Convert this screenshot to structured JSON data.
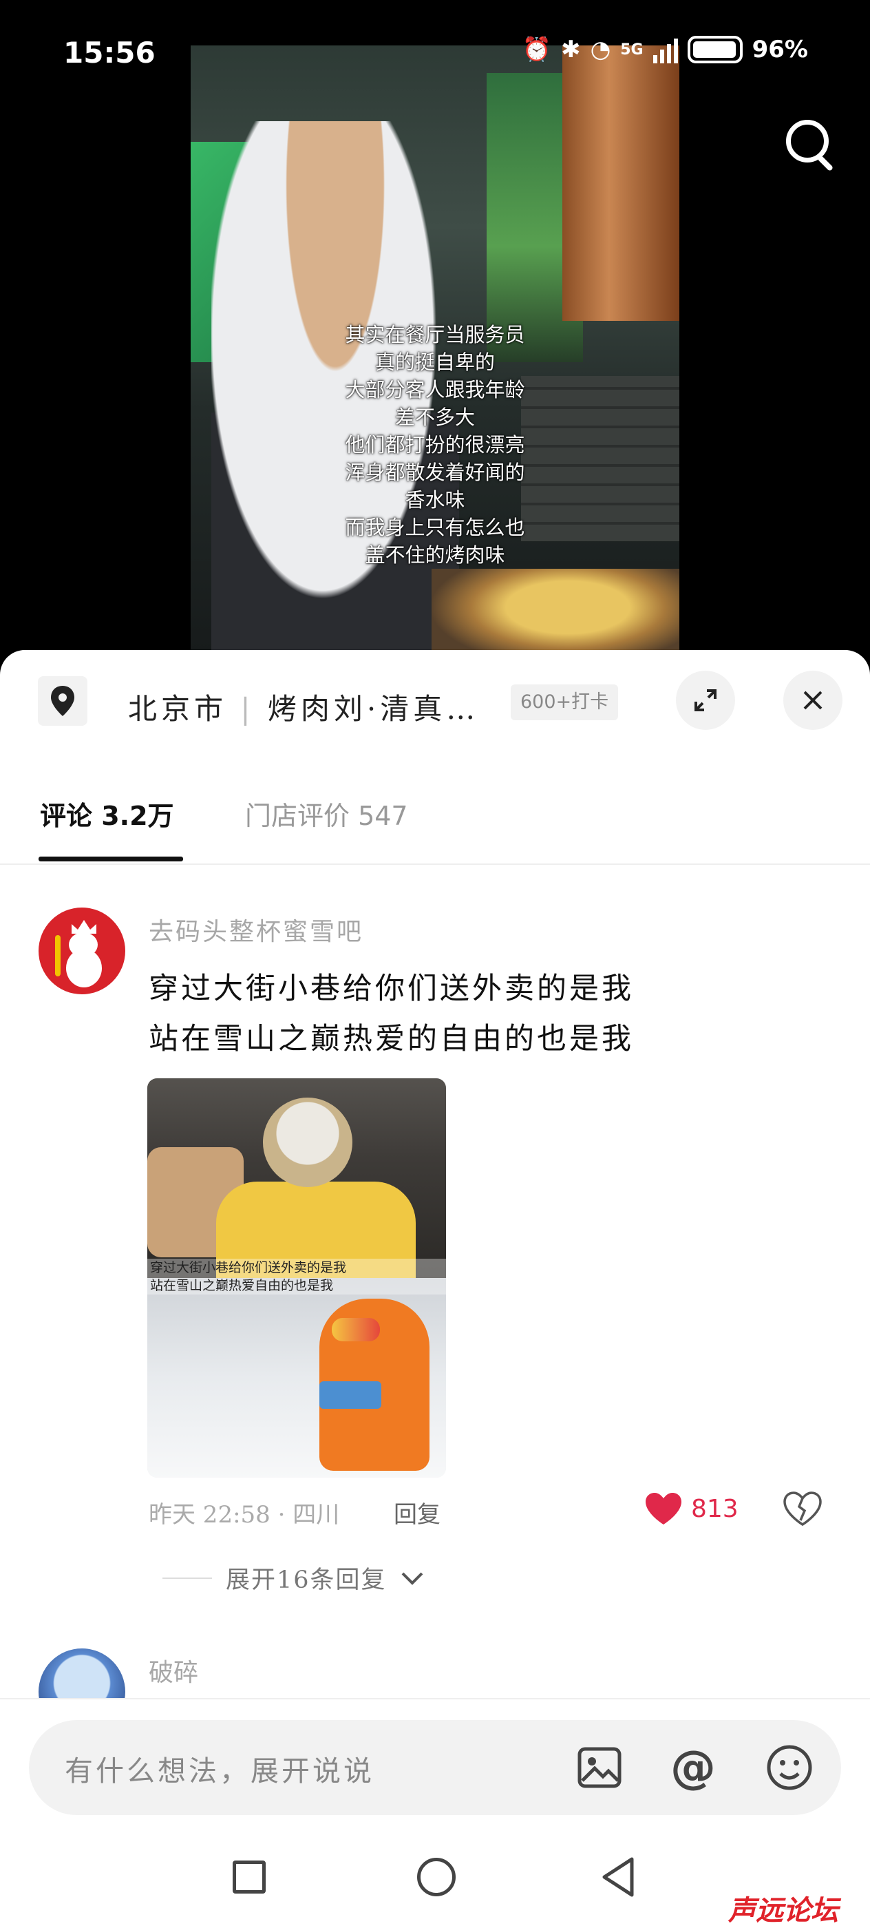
{
  "status_bar": {
    "time": "15:56",
    "network": "5G",
    "battery": "96%"
  },
  "video": {
    "caption_lines": [
      "其实在餐厅当服务员",
      "真的挺自卑的",
      "大部分客人跟我年龄",
      "差不多大",
      "他们都打扮的很漂亮",
      "浑身都散发着好闻的",
      "香水味",
      "而我身上只有怎么也",
      "盖不住的烤肉味"
    ]
  },
  "location": {
    "city": "北京市",
    "separator": "|",
    "place": "烤肉刘·清真…",
    "checkin": "600+打卡"
  },
  "tabs": [
    {
      "label": "评论 3.2万"
    },
    {
      "label": "门店评价 547"
    }
  ],
  "comment": {
    "user": "去码头整杯蜜雪吧",
    "text_line1": "穿过大街小巷给你们送外卖的是我",
    "text_line2": "站在雪山之巅热爱的自由的也是我",
    "image_caption_line1": "穿过大街小巷给你们送外卖的是我",
    "image_caption_line2": "站在雪山之巅热爱自由的也是我",
    "time_location": "昨天 22:58 · 四川",
    "reply_label": "回复",
    "likes": "813",
    "expand_replies": "展开16条回复"
  },
  "comment2": {
    "user": "破碎"
  },
  "input": {
    "placeholder": "有什么想法，展开说说"
  },
  "watermark": "声远论坛",
  "colors": {
    "like": "#e0284a",
    "brand_red": "#d8232a"
  }
}
